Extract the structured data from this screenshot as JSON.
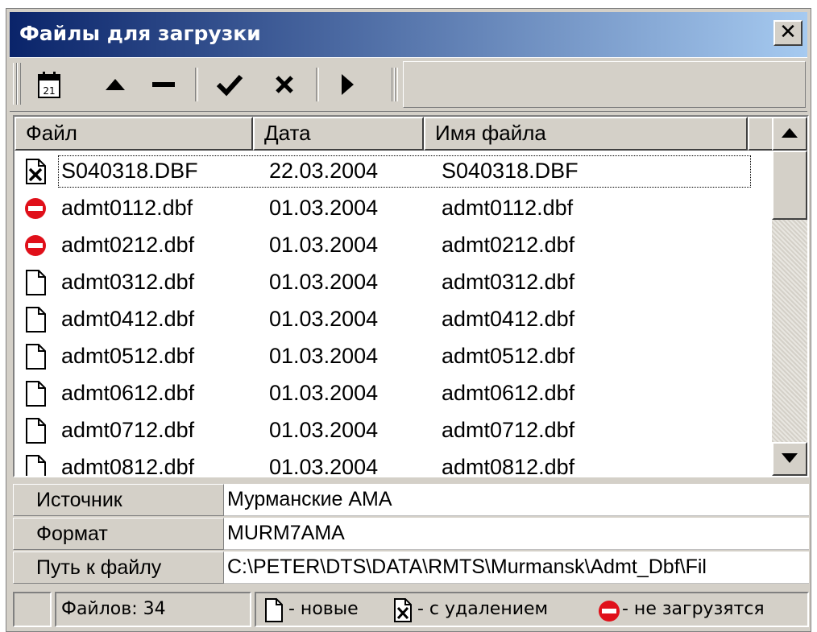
{
  "window": {
    "title": "Файлы для загрузки",
    "close_glyph": "✕"
  },
  "toolbar": {
    "buttons": [
      {
        "icon": "calendar-icon",
        "calendar_day": "21"
      },
      {
        "icon": "arrow-up-icon"
      },
      {
        "icon": "minus-icon"
      },
      {
        "icon": "check-icon"
      },
      {
        "icon": "delete-x-icon"
      },
      {
        "icon": "play-icon"
      }
    ]
  },
  "table": {
    "columns": [
      "Файл",
      "Дата",
      "Имя файла"
    ],
    "rows": [
      {
        "icon": "file-deleted-icon",
        "file": "S040318.DBF",
        "date": "22.03.2004",
        "name": "S040318.DBF",
        "selected": true
      },
      {
        "icon": "no-entry-icon",
        "file": "admt0112.dbf",
        "date": "01.03.2004",
        "name": "admt0112.dbf"
      },
      {
        "icon": "no-entry-icon",
        "file": "admt0212.dbf",
        "date": "01.03.2004",
        "name": "admt0212.dbf"
      },
      {
        "icon": "file-new-icon",
        "file": "admt0312.dbf",
        "date": "01.03.2004",
        "name": "admt0312.dbf"
      },
      {
        "icon": "file-new-icon",
        "file": "admt0412.dbf",
        "date": "01.03.2004",
        "name": "admt0412.dbf"
      },
      {
        "icon": "file-new-icon",
        "file": "admt0512.dbf",
        "date": "01.03.2004",
        "name": "admt0512.dbf"
      },
      {
        "icon": "file-new-icon",
        "file": "admt0612.dbf",
        "date": "01.03.2004",
        "name": "admt0612.dbf"
      },
      {
        "icon": "file-new-icon",
        "file": "admt0712.dbf",
        "date": "01.03.2004",
        "name": "admt0712.dbf"
      },
      {
        "icon": "file-new-icon",
        "file": "admt0812.dbf",
        "date": "01.03.2004",
        "name": "admt0812.dbf"
      }
    ]
  },
  "properties": [
    {
      "label": "Источник",
      "value": "Мурманские АМА"
    },
    {
      "label": "Формат",
      "value": "MURM7AMA"
    },
    {
      "label": "Путь к файлу",
      "value": "C:\\PETER\\DTS\\DATA\\RMTS\\Murmansk\\Admt_Dbf\\Fil"
    }
  ],
  "status": {
    "files_count": "Файлов: 34",
    "legend_new": "- новые",
    "legend_deleted": "- с удалением",
    "legend_blocked": "- не загрузятся"
  },
  "colors": {
    "title_start": "#0a246a",
    "title_end": "#a6caf0",
    "no_entry": "#e0101a",
    "face": "#d4d0c8"
  }
}
